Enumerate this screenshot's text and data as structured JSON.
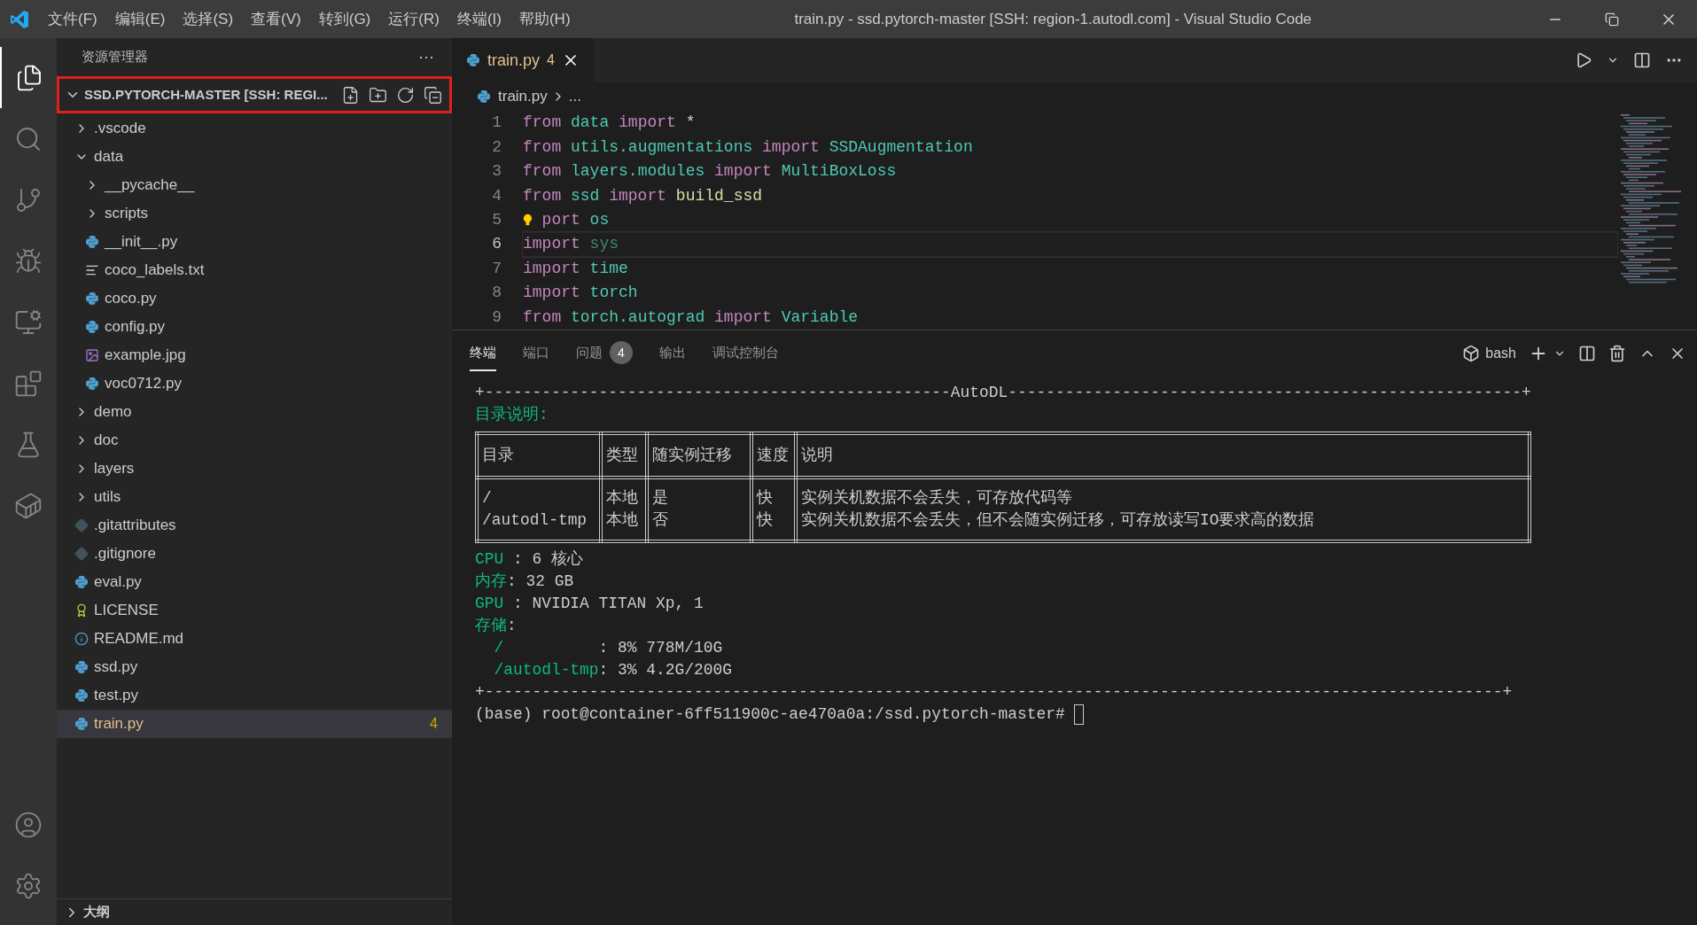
{
  "window": {
    "title": "train.py - ssd.pytorch-master [SSH: region-1.autodl.com] - Visual Studio Code"
  },
  "menu": [
    "文件(F)",
    "编辑(E)",
    "选择(S)",
    "查看(V)",
    "转到(G)",
    "运行(R)",
    "终端(I)",
    "帮助(H)"
  ],
  "explorer": {
    "title": "资源管理器",
    "more": "···",
    "folder": {
      "label": "SSD.PYTORCH-MASTER [SSH: REGI...",
      "expanded": true,
      "highlighted": true
    },
    "tree": [
      {
        "label": ".vscode",
        "kind": "folder",
        "expanded": false,
        "selected": false
      },
      {
        "label": "data",
        "kind": "folder",
        "expanded": true,
        "selected": false,
        "children": [
          {
            "label": "__pycache__",
            "kind": "folder",
            "expanded": false,
            "selected": false
          },
          {
            "label": "scripts",
            "kind": "folder",
            "expanded": false,
            "selected": false
          },
          {
            "label": "__init__.py",
            "kind": "python",
            "selected": false
          },
          {
            "label": "coco_labels.txt",
            "kind": "text",
            "selected": false
          },
          {
            "label": "coco.py",
            "kind": "python",
            "selected": false
          },
          {
            "label": "config.py",
            "kind": "python",
            "selected": false
          },
          {
            "label": "example.jpg",
            "kind": "image",
            "selected": false
          },
          {
            "label": "voc0712.py",
            "kind": "python",
            "selected": false
          }
        ]
      },
      {
        "label": "demo",
        "kind": "folder",
        "expanded": false,
        "selected": false
      },
      {
        "label": "doc",
        "kind": "folder",
        "expanded": false,
        "selected": false
      },
      {
        "label": "layers",
        "kind": "folder",
        "expanded": false,
        "selected": false
      },
      {
        "label": "utils",
        "kind": "folder",
        "expanded": false,
        "selected": false
      },
      {
        "label": ".gitattributes",
        "kind": "git",
        "selected": false
      },
      {
        "label": ".gitignore",
        "kind": "git",
        "selected": false
      },
      {
        "label": "eval.py",
        "kind": "python",
        "selected": false
      },
      {
        "label": "LICENSE",
        "kind": "license",
        "selected": false
      },
      {
        "label": "README.md",
        "kind": "info",
        "selected": false
      },
      {
        "label": "ssd.py",
        "kind": "python",
        "selected": false
      },
      {
        "label": "test.py",
        "kind": "python",
        "selected": false
      },
      {
        "label": "train.py",
        "kind": "python",
        "selected": true,
        "modified": true,
        "badge": "4"
      }
    ],
    "outline": {
      "label": "大纲",
      "expanded": false
    }
  },
  "editor": {
    "tabs": [
      {
        "label": "train.py",
        "badge": "4",
        "modified": true,
        "selected": true
      }
    ],
    "breadcrumb": [
      "train.py",
      "..."
    ],
    "lines": [
      {
        "number": "1",
        "current": false,
        "tokens": [
          {
            "text": "from",
            "kind": "keyword"
          },
          {
            "text": "data",
            "kind": "module"
          },
          {
            "text": "import",
            "kind": "keyword"
          },
          {
            "text": "*",
            "kind": "plain"
          }
        ]
      },
      {
        "number": "2",
        "current": false,
        "tokens": [
          {
            "text": "from",
            "kind": "keyword"
          },
          {
            "text": "utils.augmentations",
            "kind": "module"
          },
          {
            "text": "import",
            "kind": "keyword"
          },
          {
            "text": "SSDAugmentation",
            "kind": "module"
          }
        ]
      },
      {
        "number": "3",
        "current": false,
        "tokens": [
          {
            "text": "from",
            "kind": "keyword"
          },
          {
            "text": "layers.modules",
            "kind": "module"
          },
          {
            "text": "import",
            "kind": "keyword"
          },
          {
            "text": "MultiBoxLoss",
            "kind": "module"
          }
        ]
      },
      {
        "number": "4",
        "current": false,
        "tokens": [
          {
            "text": "from",
            "kind": "keyword"
          },
          {
            "text": "ssd",
            "kind": "module"
          },
          {
            "text": "import",
            "kind": "keyword"
          },
          {
            "text": "build_ssd",
            "kind": "function"
          }
        ]
      },
      {
        "number": "5",
        "current": false,
        "lightbulb": true,
        "tokens": [
          {
            "text": "port",
            "kind": "keyword"
          },
          {
            "text": "os",
            "kind": "module"
          }
        ]
      },
      {
        "number": "6",
        "current": true,
        "tokens": [
          {
            "text": "import",
            "kind": "keyword"
          },
          {
            "text": "sys",
            "kind": "unused"
          }
        ]
      },
      {
        "number": "7",
        "current": false,
        "tokens": [
          {
            "text": "import",
            "kind": "keyword"
          },
          {
            "text": "time",
            "kind": "module"
          }
        ]
      },
      {
        "number": "8",
        "current": false,
        "tokens": [
          {
            "text": "import",
            "kind": "keyword"
          },
          {
            "text": "torch",
            "kind": "module"
          }
        ]
      },
      {
        "number": "9",
        "current": false,
        "tokens": [
          {
            "text": "from",
            "kind": "keyword"
          },
          {
            "text": "torch.autograd",
            "kind": "module"
          },
          {
            "text": "import",
            "kind": "keyword"
          },
          {
            "text": "Variable",
            "kind": "module"
          }
        ]
      }
    ]
  },
  "panel": {
    "tabs": [
      {
        "label": "终端",
        "selected": true
      },
      {
        "label": "端口",
        "selected": false
      },
      {
        "label": "问题",
        "selected": false,
        "badge": "4"
      },
      {
        "label": "输出",
        "selected": false
      },
      {
        "label": "调试控制台",
        "selected": false
      }
    ],
    "shell": "bash",
    "terminal": {
      "banner": "+-------------------------------------------------AutoDL------------------------------------------------------+",
      "heading": "目录说明:",
      "table": {
        "columns": [
          "目录",
          "类型",
          "随实例迁移",
          "速度",
          "说明"
        ],
        "rows": [
          {
            "cells": [
              [
                "/",
                "/autodl-tmp"
              ],
              [
                "本地",
                "本地"
              ],
              [
                "是",
                "否"
              ],
              [
                "快",
                "快"
              ],
              [
                "实例关机数据不会丢失，可存放代码等",
                "实例关机数据不会丢失，但不会随实例迁移，可存放读写IO要求高的数据"
              ]
            ]
          }
        ]
      },
      "info": [
        [
          {
            "text": "CPU",
            "kind": "label"
          },
          {
            "text": " : 6 核心",
            "kind": "value"
          }
        ],
        [
          {
            "text": "内存",
            "kind": "label"
          },
          {
            "text": ": 32 GB",
            "kind": "value"
          }
        ],
        [
          {
            "text": "GPU",
            "kind": "label"
          },
          {
            "text": " : NVIDIA TITAN Xp, 1",
            "kind": "value"
          }
        ],
        [
          {
            "text": "存储",
            "kind": "label"
          },
          {
            "text": ":",
            "kind": "value"
          }
        ],
        [
          {
            "text": "  /",
            "kind": "label"
          },
          {
            "text": "          : 8% 778M/10G",
            "kind": "value"
          }
        ],
        [
          {
            "text": "  /autodl-tmp",
            "kind": "label"
          },
          {
            "text": ": 3% 4.2G/200G",
            "kind": "value"
          }
        ]
      ],
      "footer": "+-----------------------------------------------------------------------------------------------------------+",
      "prompt": "(base) root@container-6ff511900c-ae470a0a:/ssd.pytorch-master#"
    }
  }
}
